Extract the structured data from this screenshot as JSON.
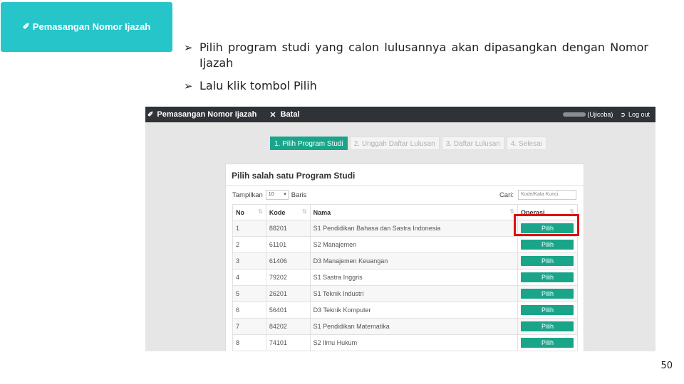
{
  "slide": {
    "title": "Pemasangan Nomor Ijazah",
    "bullets": [
      "Pilih program studi yang calon lulusannya akan dipasangkan dengan Nomor Ijazah",
      "Lalu klik tombol Pilih"
    ],
    "page_number": "50"
  },
  "app": {
    "navbar": {
      "title": "Pemasangan Nomor Ijazah",
      "batal_label": "Batal",
      "user_role": "(Ujicoba)",
      "logout_label": "Log out"
    },
    "steps": [
      "1. Pilih Program Studi",
      "2. Unggah Daftar Lulusan",
      "3. Daftar Lulusan",
      "4. Selesai"
    ],
    "active_step": 0,
    "panel": {
      "title": "Pilih salah satu Program Studi",
      "show_label": "Tampilkan",
      "show_value": "10",
      "rows_label": "Baris",
      "search_label": "Cari:",
      "search_placeholder": "Kode/Kata Kunci"
    },
    "table": {
      "headers": [
        "No",
        "Kode",
        "Nama",
        "Operasi"
      ],
      "button_label": "Pilih",
      "rows": [
        {
          "no": "1",
          "kode": "88201",
          "nama": "S1 Pendidikan Bahasa dan Sastra Indonesia"
        },
        {
          "no": "2",
          "kode": "61101",
          "nama": "S2 Manajemen"
        },
        {
          "no": "3",
          "kode": "61406",
          "nama": "D3 Manajemen Keuangan"
        },
        {
          "no": "4",
          "kode": "79202",
          "nama": "S1 Sastra Inggris"
        },
        {
          "no": "5",
          "kode": "26201",
          "nama": "S1 Teknik Industri"
        },
        {
          "no": "6",
          "kode": "56401",
          "nama": "D3 Teknik Komputer"
        },
        {
          "no": "7",
          "kode": "84202",
          "nama": "S1 Pendidikan Matematika"
        },
        {
          "no": "8",
          "kode": "74101",
          "nama": "S2 Ilmu Hukum"
        }
      ]
    }
  },
  "colors": {
    "title_badge": "#26c5c9",
    "navbar": "#2f3237",
    "accent_button": "#1aa58a",
    "highlight_box": "#e01010"
  },
  "icons": {
    "title": "pencil-icon",
    "batal": "close-icon",
    "logout": "logout-icon",
    "bullet": "arrow-bullet-icon"
  }
}
